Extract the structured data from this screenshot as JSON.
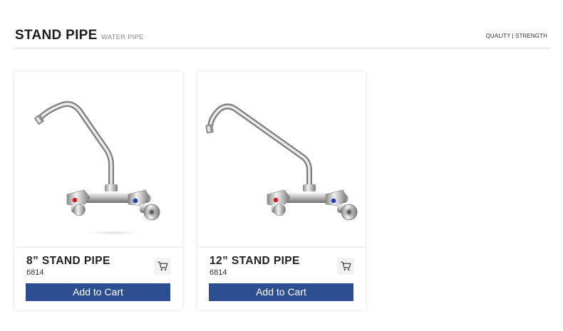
{
  "header": {
    "title": "STAND PIPE",
    "subtitle": "WATER PIPE",
    "tagline": "QUALITY | STRENGTH"
  },
  "products": [
    {
      "name": "8” STAND PIPE",
      "code": "6814",
      "add_to_cart_label": "Add to Cart",
      "cart_icon": "shopping-cart-icon",
      "image": "wall-mounted-faucet-short-spout"
    },
    {
      "name": "12” STAND PIPE",
      "code": "6814",
      "add_to_cart_label": "Add to Cart",
      "cart_icon": "shopping-cart-icon",
      "image": "wall-mounted-faucet-long-spout"
    }
  ],
  "colors": {
    "button_background": "#2d4f91",
    "hot_indicator": "#d21d1d",
    "cold_indicator": "#1f3fb5"
  }
}
